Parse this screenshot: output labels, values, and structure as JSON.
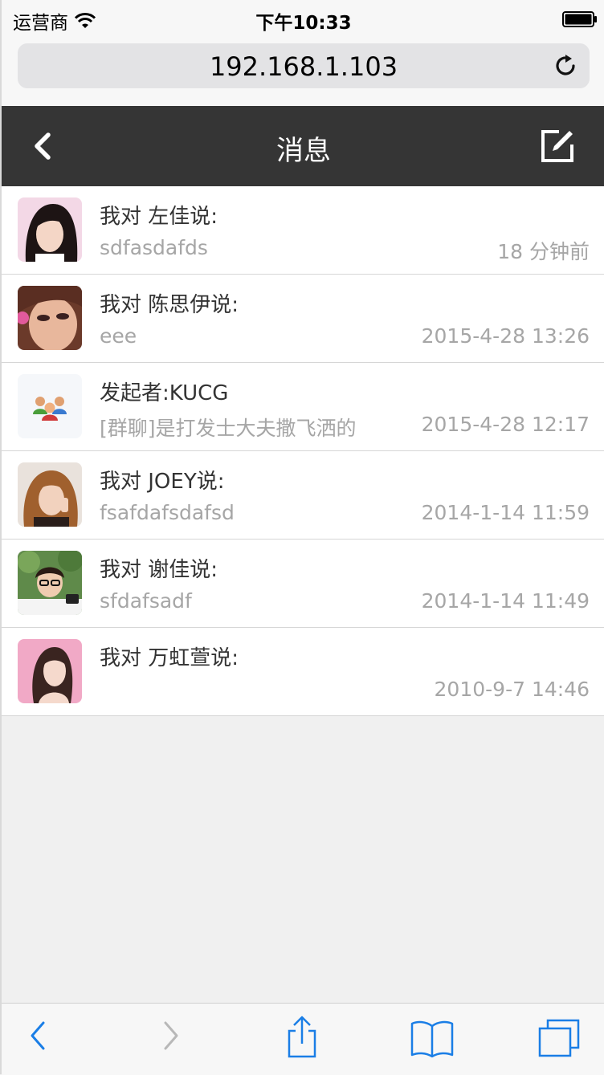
{
  "status_bar": {
    "carrier": "运营商",
    "time": "下午10:33"
  },
  "browser": {
    "url": "192.168.1.103"
  },
  "header": {
    "title": "消息"
  },
  "messages": [
    {
      "title": "我对 左佳说:",
      "preview": "sdfasdafds",
      "time": "18 分钟前",
      "avatar": "avatar-photo"
    },
    {
      "title": "我对 陈思伊说:",
      "preview": "eee",
      "time": "2015-4-28 13:26",
      "avatar": "avatar-photo"
    },
    {
      "title": "发起者:KUCG",
      "preview": "[群聊]是打发士大夫撒飞洒的",
      "time": "2015-4-28 12:17",
      "avatar": "group-chat-icon"
    },
    {
      "title": "我对 JOEY说:",
      "preview": "fsafdafsdafsd",
      "time": "2014-1-14 11:59",
      "avatar": "avatar-photo"
    },
    {
      "title": "我对 谢佳说:",
      "preview": "sfdafsadf",
      "time": "2014-1-14 11:49",
      "avatar": "avatar-photo"
    },
    {
      "title": "我对 万虹萱说:",
      "preview": "",
      "time": "2010-9-7 14:46",
      "avatar": "avatar-photo"
    }
  ],
  "colors": {
    "header_bg": "#353535",
    "ios_blue": "#1a7ee6",
    "muted_text": "#a6a6a6"
  }
}
